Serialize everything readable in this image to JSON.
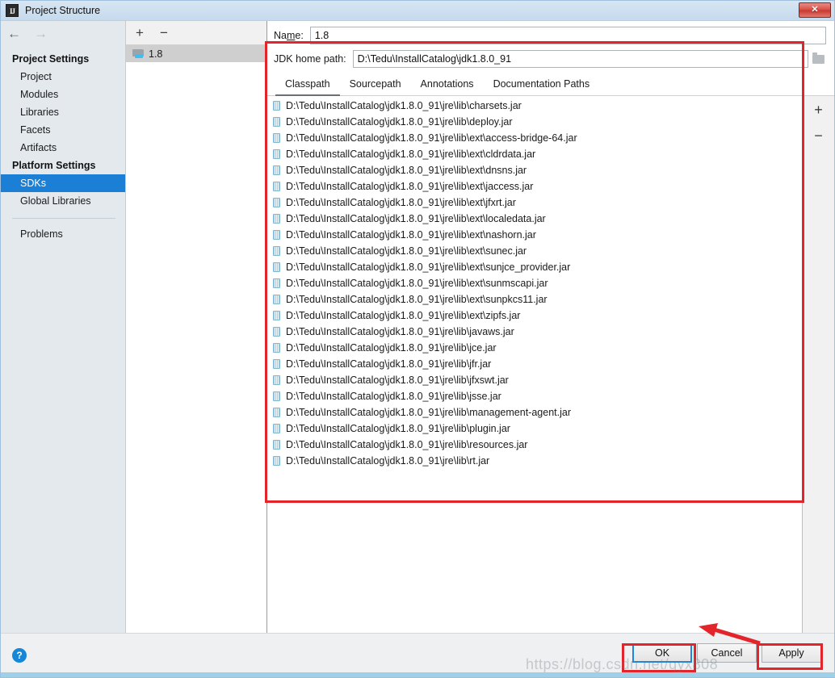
{
  "window": {
    "title": "Project Structure",
    "app_icon": "intellij-idea-icon",
    "close_label": "✕"
  },
  "nav": {
    "back_icon": "←",
    "forward_icon": "→",
    "groups": [
      {
        "label": "Project Settings",
        "items": [
          {
            "label": "Project",
            "selected": false
          },
          {
            "label": "Modules",
            "selected": false
          },
          {
            "label": "Libraries",
            "selected": false
          },
          {
            "label": "Facets",
            "selected": false
          },
          {
            "label": "Artifacts",
            "selected": false
          }
        ]
      },
      {
        "label": "Platform Settings",
        "items": [
          {
            "label": "SDKs",
            "selected": true
          },
          {
            "label": "Global Libraries",
            "selected": false
          }
        ]
      }
    ],
    "problems_label": "Problems"
  },
  "sdk_panel": {
    "add_icon": "+",
    "remove_icon": "−",
    "items": [
      {
        "label": "1.8",
        "selected": true
      }
    ]
  },
  "form": {
    "name_label": "Name:",
    "name_label_pre": "Na",
    "name_label_accel": "m",
    "name_label_post": "e:",
    "name_value": "1.8",
    "jdk_home_label": "JDK home path:",
    "jdk_home_value": "D:\\Tedu\\InstallCatalog\\jdk1.8.0_91",
    "browse_icon": "folder-icon"
  },
  "tabs": [
    {
      "label": "Classpath",
      "active": true
    },
    {
      "label": "Sourcepath",
      "active": false
    },
    {
      "label": "Annotations",
      "active": false
    },
    {
      "label": "Documentation Paths",
      "active": false
    }
  ],
  "classpath": {
    "add_icon": "+",
    "remove_icon": "−",
    "entries": [
      "D:\\Tedu\\InstallCatalog\\jdk1.8.0_91\\jre\\lib\\charsets.jar",
      "D:\\Tedu\\InstallCatalog\\jdk1.8.0_91\\jre\\lib\\deploy.jar",
      "D:\\Tedu\\InstallCatalog\\jdk1.8.0_91\\jre\\lib\\ext\\access-bridge-64.jar",
      "D:\\Tedu\\InstallCatalog\\jdk1.8.0_91\\jre\\lib\\ext\\cldrdata.jar",
      "D:\\Tedu\\InstallCatalog\\jdk1.8.0_91\\jre\\lib\\ext\\dnsns.jar",
      "D:\\Tedu\\InstallCatalog\\jdk1.8.0_91\\jre\\lib\\ext\\jaccess.jar",
      "D:\\Tedu\\InstallCatalog\\jdk1.8.0_91\\jre\\lib\\ext\\jfxrt.jar",
      "D:\\Tedu\\InstallCatalog\\jdk1.8.0_91\\jre\\lib\\ext\\localedata.jar",
      "D:\\Tedu\\InstallCatalog\\jdk1.8.0_91\\jre\\lib\\ext\\nashorn.jar",
      "D:\\Tedu\\InstallCatalog\\jdk1.8.0_91\\jre\\lib\\ext\\sunec.jar",
      "D:\\Tedu\\InstallCatalog\\jdk1.8.0_91\\jre\\lib\\ext\\sunjce_provider.jar",
      "D:\\Tedu\\InstallCatalog\\jdk1.8.0_91\\jre\\lib\\ext\\sunmscapi.jar",
      "D:\\Tedu\\InstallCatalog\\jdk1.8.0_91\\jre\\lib\\ext\\sunpkcs11.jar",
      "D:\\Tedu\\InstallCatalog\\jdk1.8.0_91\\jre\\lib\\ext\\zipfs.jar",
      "D:\\Tedu\\InstallCatalog\\jdk1.8.0_91\\jre\\lib\\javaws.jar",
      "D:\\Tedu\\InstallCatalog\\jdk1.8.0_91\\jre\\lib\\jce.jar",
      "D:\\Tedu\\InstallCatalog\\jdk1.8.0_91\\jre\\lib\\jfr.jar",
      "D:\\Tedu\\InstallCatalog\\jdk1.8.0_91\\jre\\lib\\jfxswt.jar",
      "D:\\Tedu\\InstallCatalog\\jdk1.8.0_91\\jre\\lib\\jsse.jar",
      "D:\\Tedu\\InstallCatalog\\jdk1.8.0_91\\jre\\lib\\management-agent.jar",
      "D:\\Tedu\\InstallCatalog\\jdk1.8.0_91\\jre\\lib\\plugin.jar",
      "D:\\Tedu\\InstallCatalog\\jdk1.8.0_91\\jre\\lib\\resources.jar",
      "D:\\Tedu\\InstallCatalog\\jdk1.8.0_91\\jre\\lib\\rt.jar"
    ]
  },
  "footer": {
    "help_icon": "?",
    "ok_label": "OK",
    "cancel_label": "Cancel",
    "apply_label": "Apply"
  },
  "annotations": {
    "accent_color": "#e3242b",
    "focus_color": "#1f85de",
    "selection_color": "#1c7fd6",
    "watermark_text": "https://blog.csdn.net/qyx808"
  }
}
